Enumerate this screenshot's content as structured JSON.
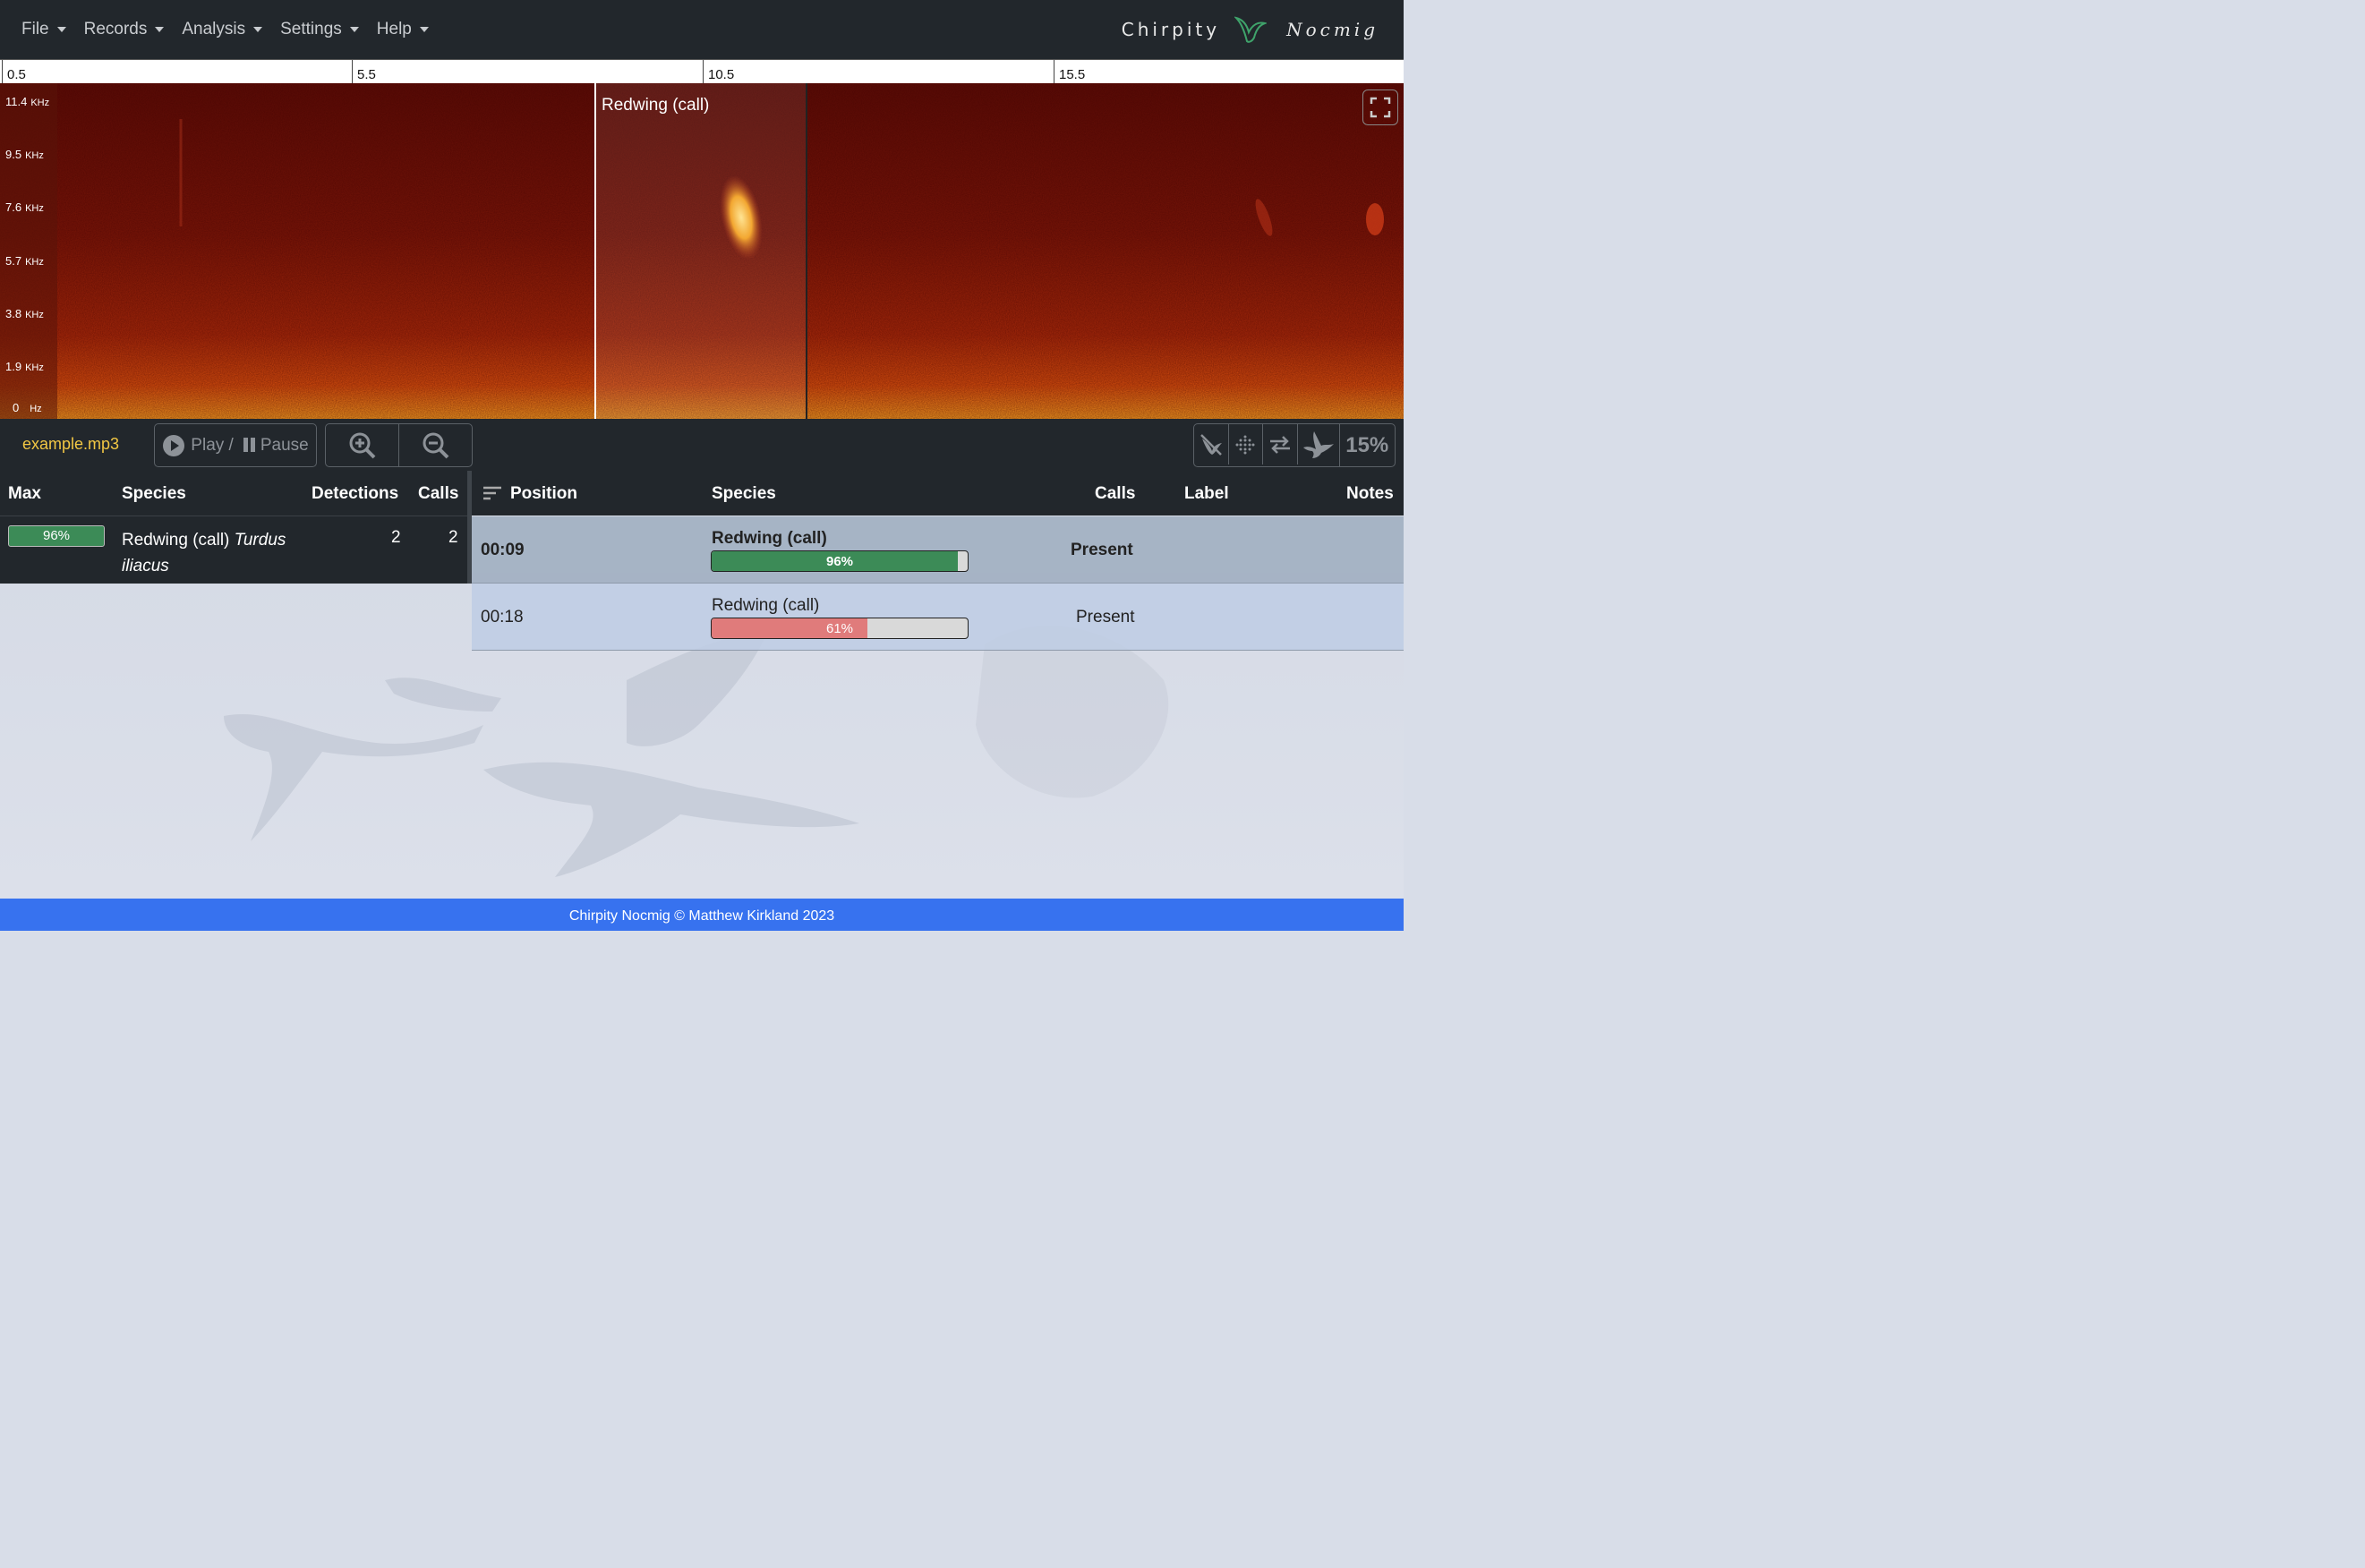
{
  "navbar": {
    "menu": [
      {
        "label": "File"
      },
      {
        "label": "Records"
      },
      {
        "label": "Analysis"
      },
      {
        "label": "Settings"
      },
      {
        "label": "Help"
      }
    ],
    "brand_left": "Chirpity",
    "brand_right": "Nocmig"
  },
  "timeline": {
    "ticks": [
      "0.5",
      "5.5",
      "10.5",
      "15.5"
    ]
  },
  "spectrogram": {
    "freq_labels": [
      {
        "value": "11.4",
        "unit": "KHz"
      },
      {
        "value": "9.5",
        "unit": "KHz"
      },
      {
        "value": "7.6",
        "unit": "KHz"
      },
      {
        "value": "5.7",
        "unit": "KHz"
      },
      {
        "value": "3.8",
        "unit": "KHz"
      },
      {
        "value": "1.9",
        "unit": "KHz"
      },
      {
        "value": "0",
        "unit": "Hz"
      }
    ],
    "region_label": "Redwing (call)"
  },
  "controls": {
    "filename": "example.mp3",
    "play_label": "Play /",
    "pause_label": "Pause",
    "confidence": "15%"
  },
  "summary": {
    "headers": {
      "max": "Max",
      "species": "Species",
      "detections": "Detections",
      "calls": "Calls"
    },
    "rows": [
      {
        "max": "96%",
        "max_value": 0.96,
        "species_common": "Redwing (call)",
        "species_latin": "Turdus iliacus",
        "detections": "2",
        "calls": "2"
      }
    ]
  },
  "results": {
    "headers": {
      "position": "Position",
      "species": "Species",
      "calls": "Calls",
      "label": "Label",
      "notes": "Notes"
    },
    "rows": [
      {
        "position": "00:09",
        "species": "Redwing (call)",
        "score": "96%",
        "score_value": 0.96,
        "calls": "Present",
        "label": "",
        "notes": ""
      },
      {
        "position": "00:18",
        "species": "Redwing (call)",
        "score": "61%",
        "score_value": 0.61,
        "calls": "Present",
        "label": "",
        "notes": ""
      }
    ]
  },
  "colors": {
    "high_score": "#3c8b57",
    "low_score": "#e07b7b",
    "accent": "#f2c744",
    "footer": "#3772ef"
  },
  "footer": "Chirpity Nocmig © Matthew Kirkland 2023"
}
